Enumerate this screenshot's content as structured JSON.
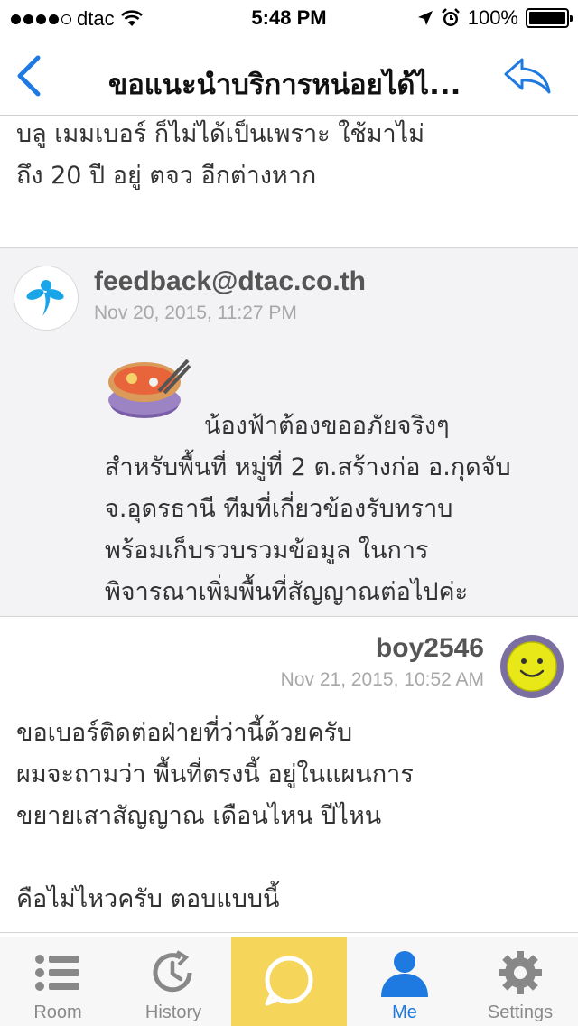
{
  "status_bar": {
    "carrier": "dtac",
    "time": "5:48 PM",
    "battery": "100%",
    "signal_bars": 4
  },
  "nav": {
    "title": "ขอแนะนำบริการหน่อยได้ไ...",
    "back_icon": "chevron-left-icon",
    "reply_icon": "reply-icon"
  },
  "colors": {
    "accent": "#1e7ae0",
    "highlight_tab": "#f5d55a",
    "staff_post_bg": "#f3f3f5"
  },
  "posts": [
    {
      "text": "บลู เมมเบอร์ ก็ไม่ได้เป็นเพราะ ใช้มาไม่\nถึง 20 ปี อยู่ ตจว อีกต่างหาก"
    },
    {
      "author": "feedback@dtac.co.th",
      "date": "Nov 20, 2015, 11:27 PM",
      "avatar_icon": "dtac-logo-icon",
      "emoticon": "noodle-bowl-emoticon",
      "text": "น้องฟ้าต้องขออภัยจริงๆ\nสำหรับพื้นที่ หมู่ที่ 2 ต.สร้างก่อ อ.กุดจับ\nจ.อุดรธานี ทีมที่เกี่ยวข้องรับทราบ\nพร้อมเก็บรวบรวมข้อมูล ในการ\nพิจารณาเพิ่มพื้นที่สัญญาณต่อไปค่ะ"
    },
    {
      "author": "boy2546",
      "date": "Nov 21, 2015, 10:52 AM",
      "avatar_icon": "smiley-avatar-icon",
      "text": "ขอเบอร์ติดต่อฝ่ายที่ว่านี้ด้วยครับ\nผมจะถามว่า พื้นที่ตรงนี้ อยู่ในแผนการ\nขยายเสาสัญญาณ เดือนไหน ปีไหน\n\nคือไม่ไหวครับ ตอบแบบนี้"
    }
  ],
  "tabs": [
    {
      "label": "Room",
      "icon": "list-icon"
    },
    {
      "label": "History",
      "icon": "history-clock-icon"
    },
    {
      "label": "",
      "icon": "chat-bubble-icon"
    },
    {
      "label": "Me",
      "icon": "person-icon"
    },
    {
      "label": "Settings",
      "icon": "gear-icon"
    }
  ]
}
